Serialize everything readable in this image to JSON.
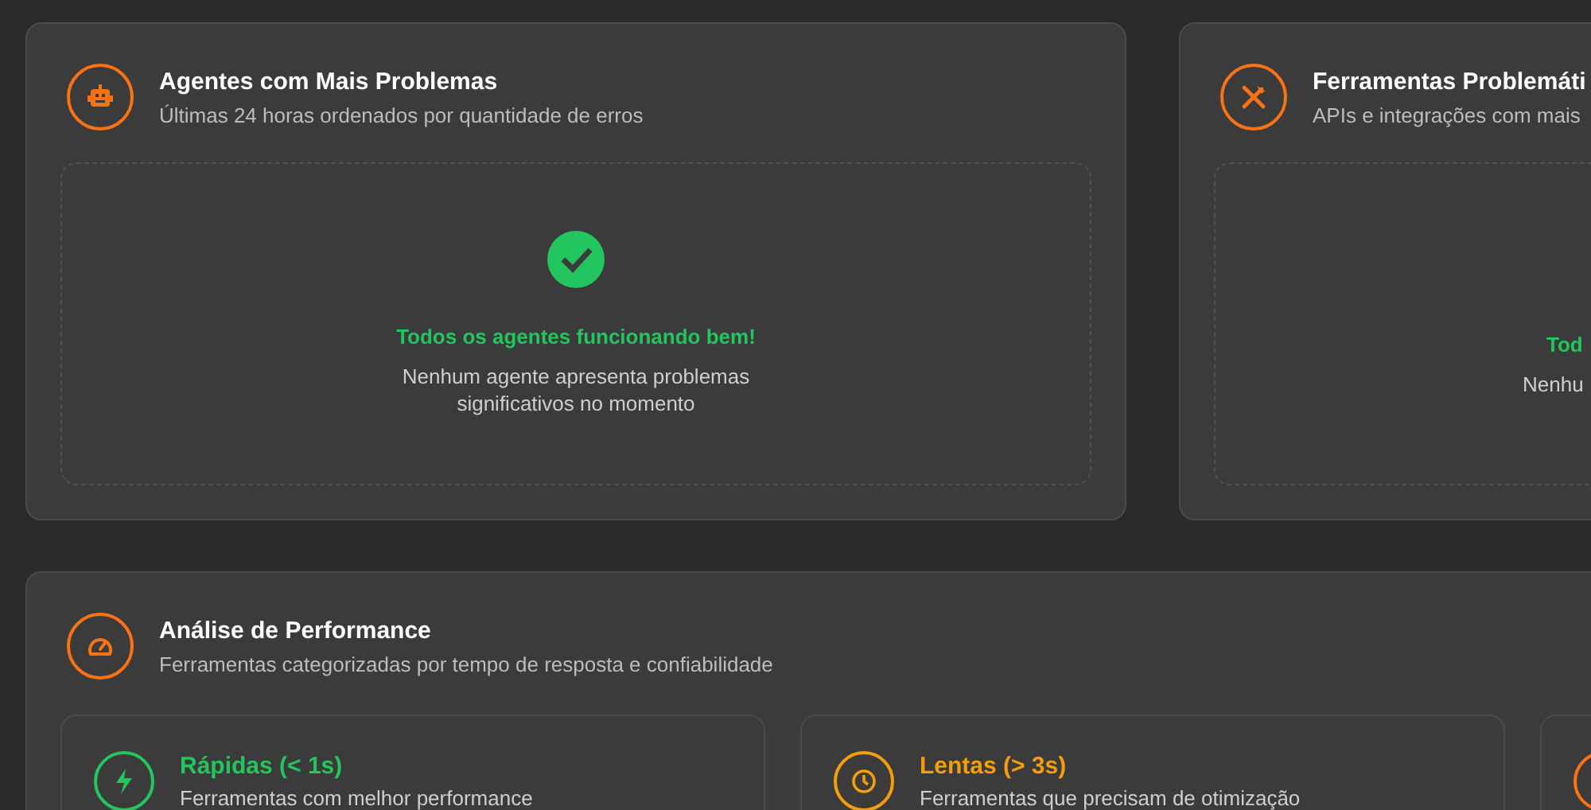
{
  "panels": [
    {
      "title": "Agentes com Mais Problemas",
      "subtitle": "Últimas 24 horas ordenados por quantidade de erros",
      "empty": {
        "title": "Todos os agentes funcionando bem!",
        "message": "Nenhum agente apresenta problemas significativos no momento"
      }
    },
    {
      "title": "Ferramentas Problemáti",
      "subtitle": "APIs e integrações com mais",
      "empty": {
        "title": "Tod",
        "message": "Nenhu"
      }
    }
  ],
  "performance": {
    "title": "Análise de Performance",
    "subtitle": "Ferramentas categorizadas por tempo de resposta e confiabilidade",
    "categories": [
      {
        "color": "#22c55e",
        "title": "Rápidas (< 1s)",
        "subtitle": "Ferramentas com melhor performance"
      },
      {
        "color": "#f59e0b",
        "title": "Lentas (> 3s)",
        "subtitle": "Ferramentas que precisam de otimização"
      },
      {
        "color": "#f97316"
      }
    ]
  }
}
